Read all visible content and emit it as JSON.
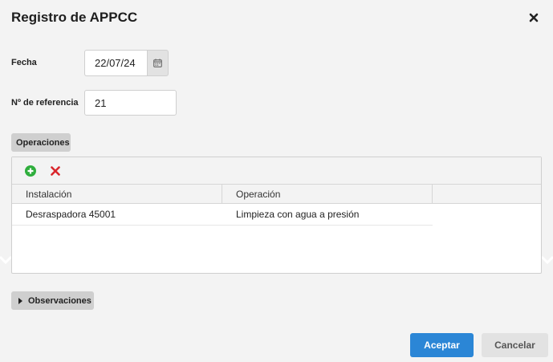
{
  "dialog": {
    "title": "Registro de APPCC"
  },
  "form": {
    "fecha_label": "Fecha",
    "fecha_value": "22/07/24",
    "referencia_label": "Nº de referencia",
    "referencia_value": "21"
  },
  "operaciones": {
    "tab_label": "Operaciones",
    "columns": [
      "Instalación",
      "Operación",
      ""
    ],
    "rows": [
      {
        "instalacion": "Desraspadora 45001",
        "operacion": "Limpieza con agua a presión"
      }
    ]
  },
  "observaciones": {
    "tab_label": "Observaciones"
  },
  "actions": {
    "accept_label": "Aceptar",
    "cancel_label": "Cancelar"
  },
  "colors": {
    "accent": "#2b86d6",
    "add": "#2fae3d",
    "delete": "#d9262c"
  },
  "icons": {
    "close": "close-icon",
    "calendar": "calendar-icon",
    "add": "add-circle-icon",
    "delete": "delete-x-icon",
    "expand": "caret-right-icon"
  }
}
